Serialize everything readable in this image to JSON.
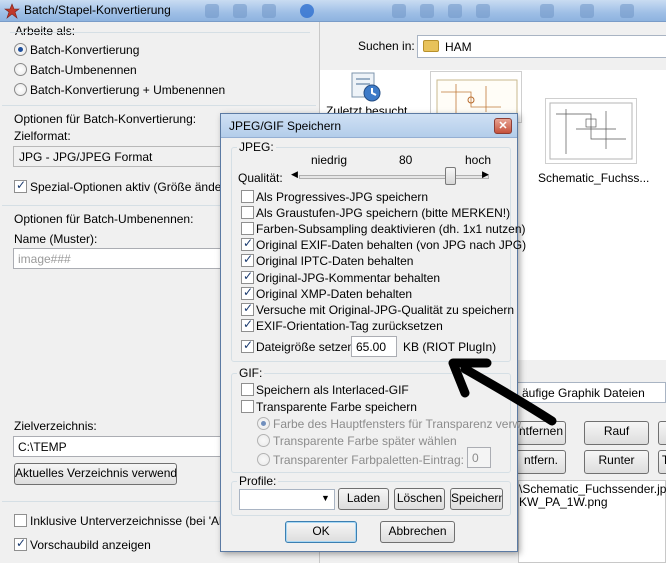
{
  "titlebar": {
    "title": "Batch/Stapel-Konvertierung"
  },
  "left": {
    "work_as_label": "Arbeite als:",
    "modes": [
      {
        "label": "Batch-Konvertierung",
        "selected": true
      },
      {
        "label": "Batch-Umbenennen",
        "selected": false
      },
      {
        "label": "Batch-Konvertierung + Umbenennen",
        "selected": false
      }
    ],
    "batch_options_label": "Optionen für Batch-Konvertierung:",
    "target_format_label": "Zielformat:",
    "target_format_value": "JPG - JPG/JPEG Format",
    "special_options_label": "Spezial-Optionen aktiv (Größe ändern etc)",
    "rename_options_label": "Optionen für Batch-Umbenennen:",
    "name_pattern_label": "Name (Muster):",
    "name_pattern_placeholder": "image###",
    "target_dir_label": "Zielverzeichnis:",
    "target_dir_value": "C:\\TEMP",
    "use_current_dir_button": "Aktuelles Verzeichnis verwenden",
    "include_subdirs_label": "Inklusive Unterverzeichnisse (bei 'Alle hinzufügen')",
    "show_preview_label": "Vorschaubild anzeigen"
  },
  "right": {
    "search_in_label": "Suchen in:",
    "folder_name": "HAM",
    "recent_label": "Zuletzt besucht",
    "thumbnail_caption": "Schematic_Fuchss...",
    "filetype_value": "äufige Graphik Dateien",
    "buttons": {
      "remove": "ntfernen",
      "up": "Rauf",
      "remove2": "ntfern.",
      "down": "Runter",
      "t": "T"
    },
    "files": [
      "\\Schematic_Fuchssender.jpg",
      "KW_PA_1W.png"
    ]
  },
  "dialog": {
    "title": "JPEG/GIF Speichern",
    "jpeg_group": "JPEG:",
    "quality_low": "niedrig",
    "quality_value": "80",
    "quality_high": "hoch",
    "quality_label": "Qualität:",
    "quality_level": 0.8,
    "jpeg_options": [
      {
        "label": "Als Progressives-JPG speichern",
        "checked": false
      },
      {
        "label": "Als Graustufen-JPG speichern (bitte MERKEN!)",
        "checked": false
      },
      {
        "label": "Farben-Subsampling deaktivieren (dh. 1x1 nutzen)",
        "checked": false
      },
      {
        "label": "Original EXIF-Daten behalten (von JPG nach JPG)",
        "checked": true
      },
      {
        "label": "Original IPTC-Daten behalten",
        "checked": true
      },
      {
        "label": "Original-JPG-Kommentar behalten",
        "checked": true
      },
      {
        "label": "Original XMP-Daten behalten",
        "checked": true
      },
      {
        "label": "Versuche mit Original-JPG-Qualität zu speichern",
        "checked": true
      },
      {
        "label": "EXIF-Orientation-Tag zurücksetzen",
        "checked": true
      }
    ],
    "filesize_label": "Dateigröße setzen:",
    "filesize_value": "65.00",
    "filesize_unit": "KB (RIOT PlugIn)",
    "gif_group": "GIF:",
    "interlaced_label": "Speichern als Interlaced-GIF",
    "transparent_label": "Transparente Farbe speichern",
    "transparency_options": [
      {
        "label": "Farbe des Hauptfensters für Transparenz verw.",
        "selected": true
      },
      {
        "label": "Transparente Farbe später wählen",
        "selected": false
      },
      {
        "label": "Transparenter Farbpaletten-Eintrag:",
        "selected": false
      }
    ],
    "palette_entry_value": "0",
    "profile_label": "Profile:",
    "profile_value": "",
    "load_button": "Laden",
    "delete_button": "Löschen",
    "save_button": "Speichern",
    "ok_button": "OK",
    "cancel_button": "Abbrechen"
  }
}
